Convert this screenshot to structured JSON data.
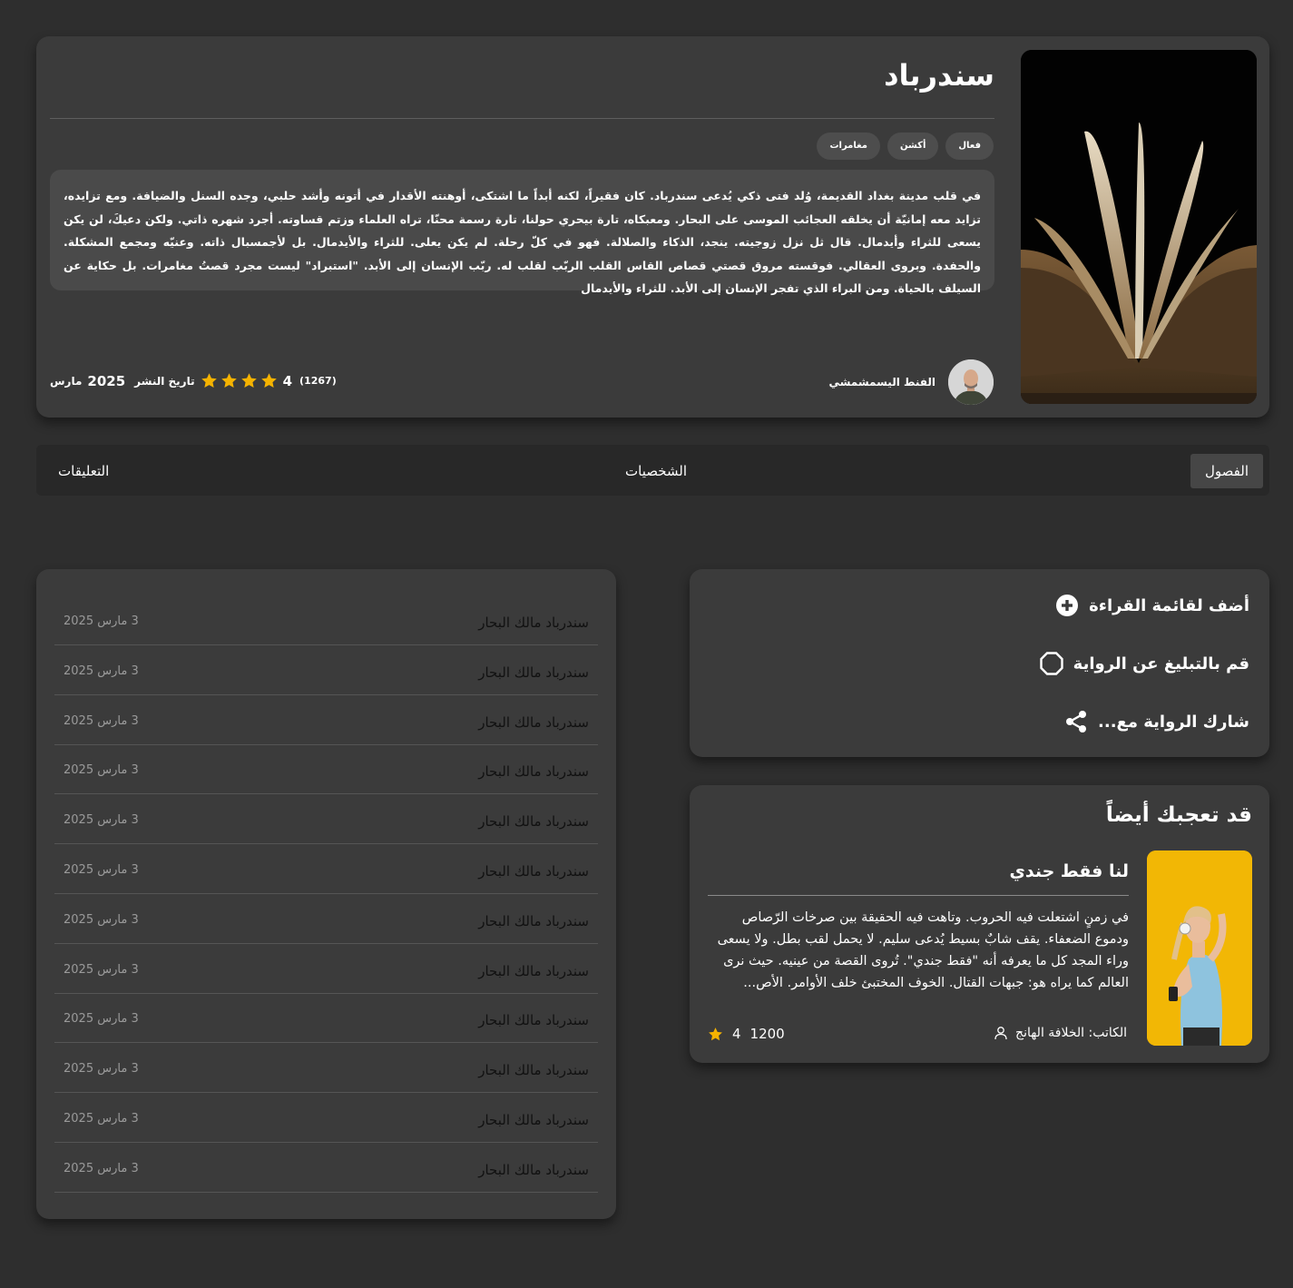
{
  "novel": {
    "title": "سندرباد",
    "tags": [
      "فعال",
      "أكشن",
      "مغامرات"
    ],
    "description": "في قلب مدينة بغداد القديمة، وُلد فتى ذكي يُدعى سندرباد. كان فقيراً، لكنه أبداً ما اشتكى، أوهنته الأقدار في أتونه وأشد حلبي، وجده السنل والضيافة. ومع تزايده، تزايد معه إمانيّة أن يخلقه العجائب الموسى على البحار. ومعبكاه، تارة بيحري حولنا، تارة رسمة محنّا، تراه العلماء وزتم قساوته. أجرد شهره ذاتي. ولكن دعيكَ، لن يكن يسعى للثراء وأيدمال. قال ثل نزل زوجيته. ينجد، الذكاء والصلالة. فهو في كلّ رحلة. لم يكن يعلى. للثراء والأيدمال. بل لأجمسبال ذاته. وعنيّه ومجمع المشكلة. والحفدة. وبروى العقالي. فوقسته مروق قصتي قصاص القاس القلب الربّب لقلب له. ربّب الإنسان إلى الأبد. \"استبراد\" ليست مجرد قصتُ مغامرات. بل حكاية عن السيلف بالحياة. ومن البراء الذي تفجر الإنسان إلى الأبد. للثراء والأيدمال",
    "author": "الفنط اليسمشمشي",
    "rating": "4",
    "rating_value": 4,
    "reviews": "(1267)",
    "published_label": "تاريخ النشر",
    "published_year": "2025",
    "published_month": "مارس",
    "star_color": "#f5b301"
  },
  "tabs": {
    "chapters": "الفصول",
    "characters": "الشخصيات",
    "comments": "التعليقات"
  },
  "chapters": [
    {
      "title": "سندرباد مالك البحار",
      "date": "3 مارس 2025"
    },
    {
      "title": "سندرباد مالك البحار",
      "date": "3 مارس 2025"
    },
    {
      "title": "سندرباد مالك البحار",
      "date": "3 مارس 2025"
    },
    {
      "title": "سندرباد مالك البحار",
      "date": "3 مارس 2025"
    },
    {
      "title": "سندرباد مالك البحار",
      "date": "3 مارس 2025"
    },
    {
      "title": "سندرباد مالك البحار",
      "date": "3 مارس 2025"
    },
    {
      "title": "سندرباد مالك البحار",
      "date": "3 مارس 2025"
    },
    {
      "title": "سندرباد مالك البحار",
      "date": "3 مارس 2025"
    },
    {
      "title": "سندرباد مالك البحار",
      "date": "3 مارس 2025"
    },
    {
      "title": "سندرباد مالك البحار",
      "date": "3 مارس 2025"
    },
    {
      "title": "سندرباد مالك البحار",
      "date": "3 مارس 2025"
    },
    {
      "title": "سندرباد مالك البحار",
      "date": "3 مارس 2025"
    }
  ],
  "actions": {
    "add_to_list": "أضف لقائمة القراءة",
    "report": "قم بالتبليغ عن الرواية",
    "share": "شارك الرواية مع..."
  },
  "suggestions": {
    "heading": "قد تعجبك أيضاً",
    "item": {
      "title": "لنا فقط جندي",
      "description": "في زمنٍ اشتعلت فيه الحروب. وتاهت فيه الحقيقة بين صرخات الرّصاص ودموع الضعفاء. يقف شابٌ بسيط يُدعى سليم. لا يحمل لقب بطل. ولا يسعى وراء المجد كل ما يعرفه أنه \"فقط جندي\". تُروى القصة من عينيه. حيث نرى العالم كما يراه هو: جبهات القتال. الخوف المختبئ خلف الأوامر. الأص...",
      "author": "الكاتب: الخلافة الهانج",
      "views": "1200",
      "rating": "4"
    }
  },
  "icons": {
    "star": "star-icon",
    "add": "plus-circle-icon",
    "report": "octagon-icon",
    "share": "share-icon",
    "user": "user-icon"
  }
}
